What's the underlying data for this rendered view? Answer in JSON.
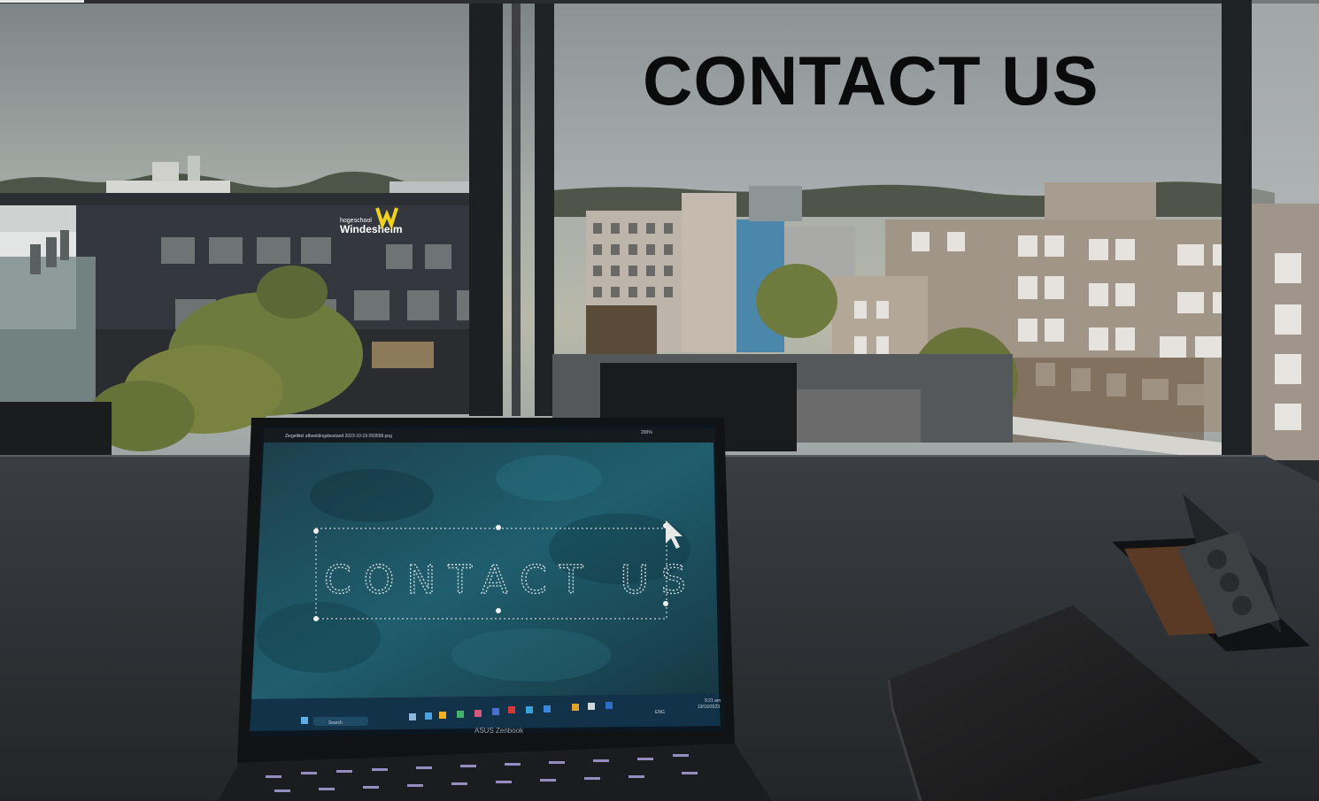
{
  "headline": "CONTACT US",
  "building_sign": {
    "small": "hogeschool",
    "large": "Windesheim"
  },
  "laptop": {
    "brand": "ASUS Zenbook",
    "screen": {
      "file_title": "Ziegeltitel afbeeldingsbestand 2023-10-19 093558.png",
      "zoom": "200%",
      "canvas_text": "CONTACT US",
      "taskbar": {
        "search": "Search",
        "language": "ENG",
        "time": "9:21 am",
        "date": "19/10/2023"
      }
    }
  },
  "colors": {
    "headline": "#0b0b0b",
    "sky": "#9ea5a6",
    "table": "#2b2e31",
    "screen_teal": "#1f5e6e"
  }
}
